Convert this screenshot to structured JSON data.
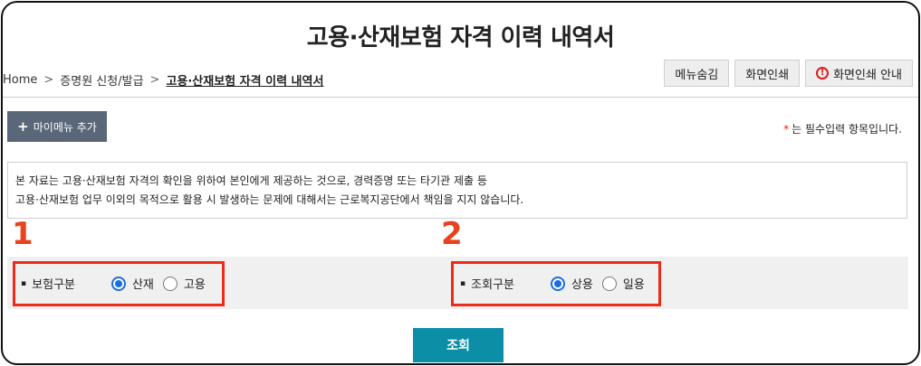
{
  "page": {
    "title": "고용·산재보험 자격 이력 내역서"
  },
  "breadcrumb": {
    "home": "Home",
    "level1": "증명원 신청/발급",
    "current": "고용·산재보험 자격 이력 내역서"
  },
  "toolbar": {
    "hide_menu": "메뉴숨김",
    "print": "화면인쇄",
    "print_guide": "화면인쇄 안내"
  },
  "mymenu": {
    "label": "마이메뉴 추가",
    "plus": "+"
  },
  "required_note": {
    "star": "*",
    "text": "는 필수입력 항목입니다."
  },
  "notice": {
    "line1": "본 자료는 고용·산재보험 자격의 확인을 위하여 본인에게 제공하는 것으로, 경력증명 또는 타기관 제출 등",
    "line2": "고용·산재보험 업무 이외의 목적으로 활용 시 발생하는 문제에 대해서는 근로복지공단에서 책임을 지지 않습니다."
  },
  "annotations": {
    "one": "1",
    "two": "2"
  },
  "insurance_type": {
    "label": "보험구분",
    "options": [
      {
        "label": "산재",
        "selected": true
      },
      {
        "label": "고용",
        "selected": false
      }
    ]
  },
  "query_type": {
    "label": "조회구분",
    "options": [
      {
        "label": "상용",
        "selected": true
      },
      {
        "label": "일용",
        "selected": false
      }
    ]
  },
  "search_button": {
    "label": "조회"
  },
  "colors": {
    "accent": "#0b8ea6",
    "annotation": "#ee2a18",
    "radio": "#1a6de0",
    "mymenu": "#5a6778"
  }
}
